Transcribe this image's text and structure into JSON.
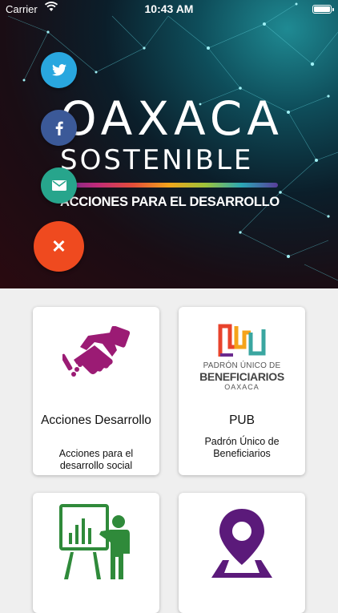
{
  "status_bar": {
    "carrier": "Carrier",
    "time": "10:43 AM"
  },
  "hero": {
    "logo_line1": "OAXACA",
    "logo_line2": "SOSTENIBLE",
    "tagline": "ACCIONES PARA EL DESARROLLO"
  },
  "share_buttons": {
    "twitter_icon": "twitter-icon",
    "facebook_icon": "facebook-icon",
    "email_icon": "envelope-icon",
    "close_label": "✕"
  },
  "cards": [
    {
      "title": "Acciones Desarrollo",
      "desc": "Acciones para el desarrollo social",
      "icon": "handshake-icon",
      "color": "#9b1b74"
    },
    {
      "title": "PUB",
      "desc": "Padrón Único de Beneficiarios",
      "icon": "pub-logo",
      "logo_l1": "PADRÓN ÚNICO DE",
      "logo_l2": "BENEFICIARIOS",
      "logo_l3": "OAXACA"
    },
    {
      "title": "",
      "desc": "",
      "icon": "presentation-icon",
      "color": "#2f8a3a"
    },
    {
      "title": "",
      "desc": "",
      "icon": "map-pin-icon",
      "color": "#5b1a7a"
    }
  ]
}
